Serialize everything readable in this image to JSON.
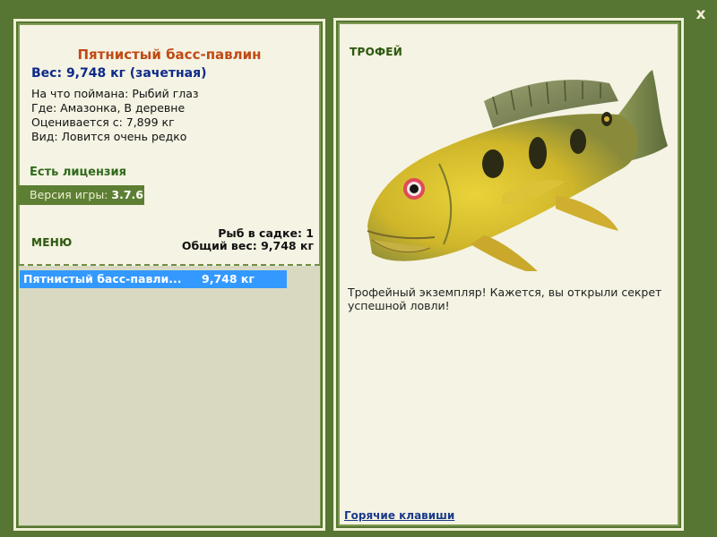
{
  "close_label": "x",
  "fish": {
    "name": "Пятнистый басс-павлин",
    "weight_line": "Вес: 9,748 кг (зачетная)",
    "caught_with": "На что поймана: Рыбий глаз",
    "location": "Где: Амазонка, В деревне",
    "rated_from": "Оценивается с: 7,899 кг",
    "rarity": "Вид: Ловится очень редко"
  },
  "license": "Есть лицензия",
  "version": {
    "label": "Версия игры:",
    "value": "3.7.6"
  },
  "menu_label": "МЕНЮ",
  "stats": {
    "fish_count": "Рыб в садке: 1",
    "total_weight": "Общий вес: 9,748 кг"
  },
  "catch_list": [
    {
      "name": "Пятнистый басс-павли...",
      "weight": "9,748 кг"
    }
  ],
  "trophy": {
    "label": "ТРОФЕЙ",
    "text": "Трофейный экземпляр! Кажется, вы открыли секрет успешной ловли!"
  },
  "hotkeys_label": "Горячие клавиши",
  "colors": {
    "frame": "#577533",
    "panel": "#f5f3e3",
    "title": "#c04a14",
    "weight": "#0c2a8a",
    "selection": "#3399ff"
  }
}
